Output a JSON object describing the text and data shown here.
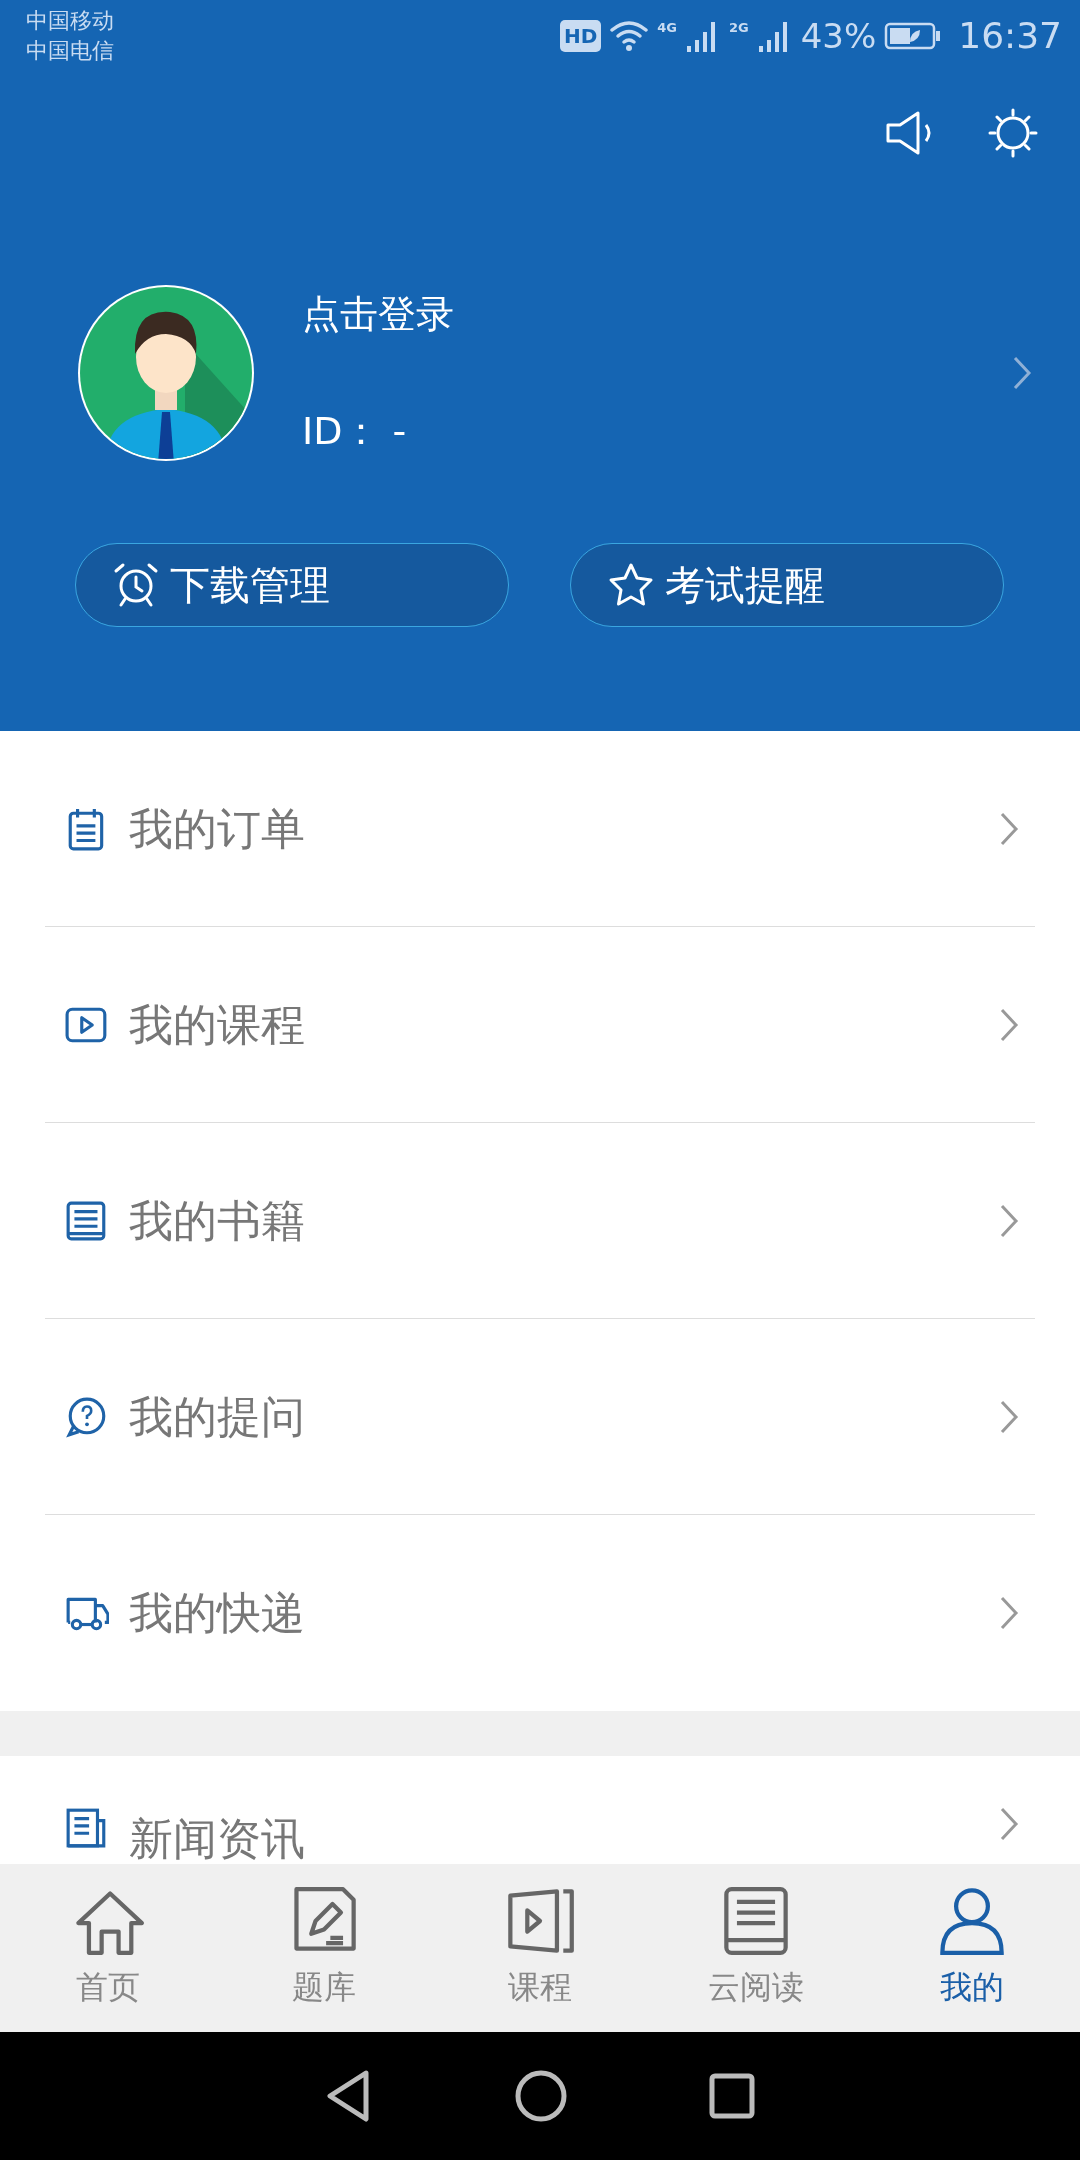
{
  "status_bar": {
    "carriers": [
      "中国移动",
      "中国电信"
    ],
    "hd_badge": "HD",
    "network_labels": [
      "4G",
      "2G"
    ],
    "battery": "43%",
    "time": "16:37"
  },
  "profile": {
    "login": "点击登录",
    "id": "ID： -"
  },
  "quick_buttons": [
    {
      "kind": "alarm",
      "label": "下载管理"
    },
    {
      "kind": "star",
      "label": "考试提醒"
    }
  ],
  "menu": [
    {
      "kind": "order",
      "label": "我的订单"
    },
    {
      "kind": "course",
      "label": "我的课程"
    },
    {
      "kind": "book",
      "label": "我的书籍"
    },
    {
      "kind": "question",
      "label": "我的提问"
    },
    {
      "kind": "delivery",
      "label": "我的快递"
    }
  ],
  "menu_2": [
    {
      "kind": "news",
      "label": "新闻资讯"
    }
  ],
  "tabs": [
    {
      "kind": "home",
      "label": "首页",
      "selected": false
    },
    {
      "kind": "exam",
      "label": "题库",
      "selected": false
    },
    {
      "kind": "course",
      "label": "课程",
      "selected": false
    },
    {
      "kind": "read",
      "label": "云阅读",
      "selected": false
    },
    {
      "kind": "me",
      "label": "我的",
      "selected": true
    }
  ]
}
